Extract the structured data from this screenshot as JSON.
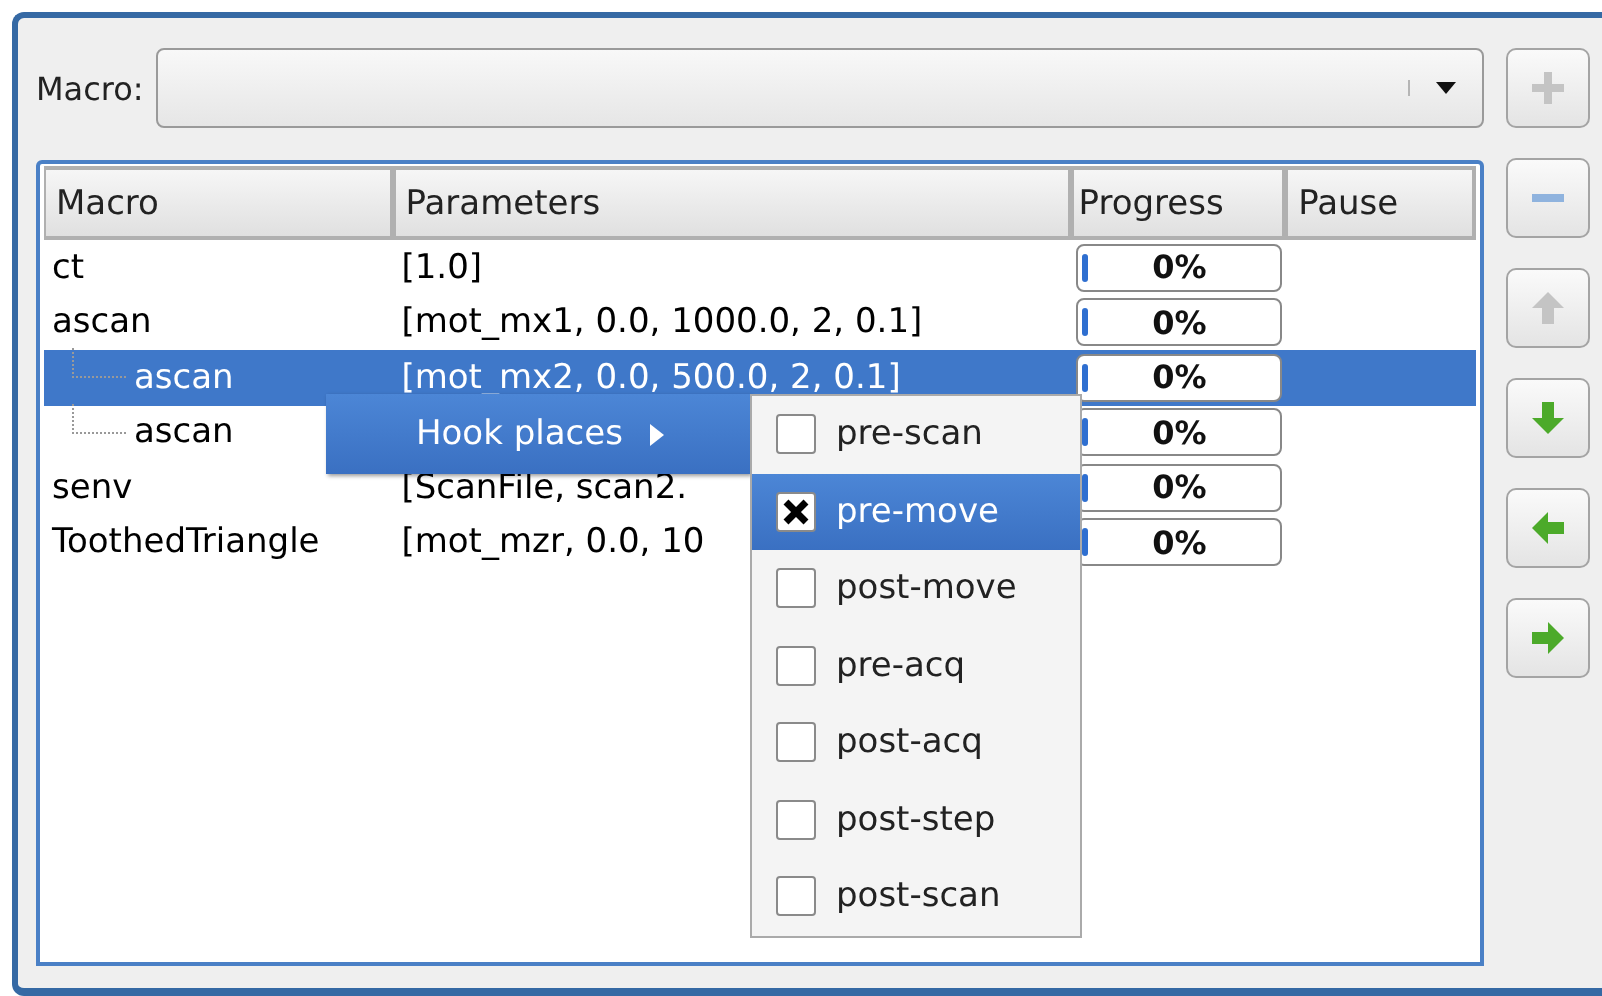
{
  "macro_selector": {
    "label": "Macro:"
  },
  "side_buttons": [
    {
      "kind": "add",
      "disabled": true
    },
    {
      "kind": "remove",
      "disabled": false
    },
    {
      "kind": "up",
      "disabled": true
    },
    {
      "kind": "down",
      "disabled": false
    },
    {
      "kind": "left",
      "disabled": false
    },
    {
      "kind": "right",
      "disabled": false
    }
  ],
  "table": {
    "columns": [
      "Macro",
      "Parameters",
      "Progress",
      "Pause"
    ],
    "rows": [
      {
        "macro": "ct",
        "parameters": "[1.0]",
        "progress": {
          "level": 0,
          "text": "0%"
        },
        "selected": false
      },
      {
        "macro": "ascan",
        "parameters": "[mot_mx1, 0.0, 1000.0, 2, 0.1]",
        "progress": {
          "level": 0,
          "text": "0%"
        },
        "selected": false,
        "children": [
          {
            "macro": "ascan",
            "parameters": "[mot_mx2, 0.0, 500.0, 2, 0.1]",
            "progress": {
              "level": 0,
              "text": "0%"
            },
            "selected": true
          },
          {
            "macro": "ascan",
            "progress": {
              "level": 0,
              "text": "0%"
            },
            "selected": false
          }
        ]
      },
      {
        "macro": "senv",
        "parameters": "[ScanFile, scan2.",
        "progress": {
          "level": 0,
          "text": "0%"
        },
        "selected": false
      },
      {
        "macro": "ToothedTriangle",
        "parameters": "[mot_mzr, 0.0, 10",
        "progress": {
          "level": 0,
          "text": "0%"
        },
        "selected": false
      }
    ]
  },
  "context_menu": {
    "items": [
      {
        "label": "Hook places",
        "selected": true,
        "submenu": [
          {
            "label": "pre-scan",
            "checked": false,
            "selected": false
          },
          {
            "label": "pre-move",
            "checked": true,
            "selected": true
          },
          {
            "label": "post-move",
            "checked": false,
            "selected": false
          },
          {
            "label": "pre-acq",
            "checked": false,
            "selected": false
          },
          {
            "label": "post-acq",
            "checked": false,
            "selected": false
          },
          {
            "label": "post-step",
            "checked": false,
            "selected": false
          },
          {
            "label": "post-scan",
            "checked": false,
            "selected": false
          }
        ]
      }
    ]
  }
}
